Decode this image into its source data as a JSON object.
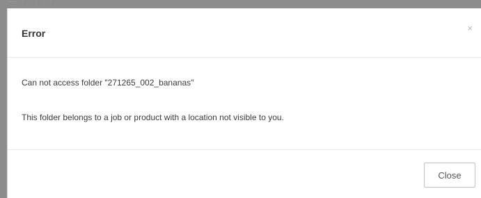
{
  "background": {
    "partial_text": "— · · · · · ·"
  },
  "dialog": {
    "title": "Error",
    "close_icon_glyph": "×",
    "message_line1": "Can not access folder \"271265_002_bananas\"",
    "message_line2": "This folder belongs to a job or product with a location not visible to you.",
    "close_button_label": "Close"
  },
  "colors": {
    "backdrop": "#8c8c8c",
    "dialog_background": "#ffffff",
    "divider": "#e8e8e8",
    "title_text": "#333333",
    "body_text": "#3a3a3a",
    "close_icon": "#b5b5b5",
    "button_border": "#c4c4c4"
  },
  "icons": {
    "close": "close-icon"
  }
}
